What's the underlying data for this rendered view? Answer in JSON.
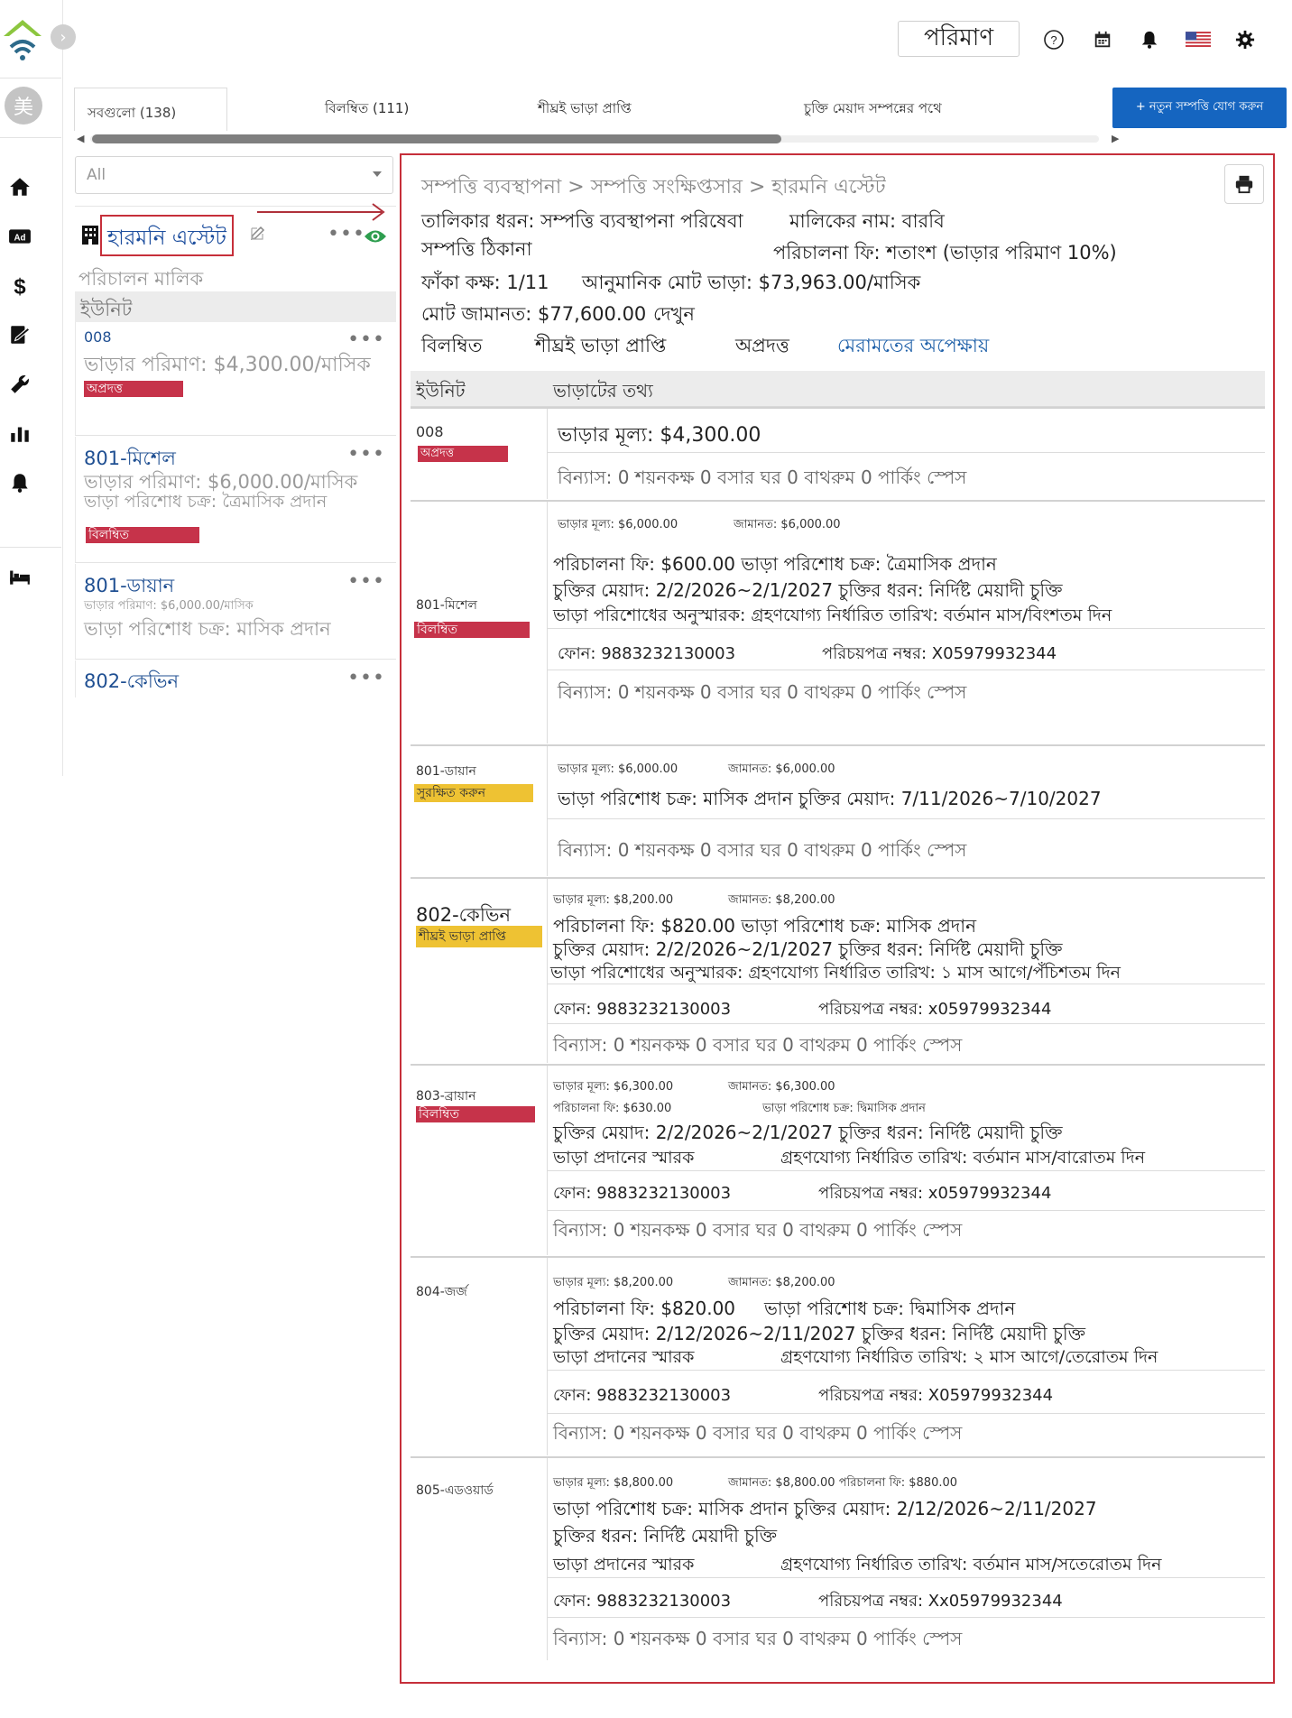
{
  "rail": {
    "avatar_text": "美"
  },
  "topbar": {
    "measure_label": "পরিমাণ"
  },
  "tabs": [
    {
      "label": "সবগুলো (138)"
    },
    {
      "label": "বিলম্বিত (111)"
    },
    {
      "label": "শীঘ্রই ভাড়া প্রাপ্তি"
    },
    {
      "label": "চুক্তি মেয়াদ সম্পন্নের পথে"
    }
  ],
  "add_button_label": "+ নতুন সম্পত্তি যোগ করুন",
  "filter": {
    "value": "All"
  },
  "property": {
    "name": "হারমনি এস্টেট",
    "owner": "পরিচালন মালিক",
    "units_heading": "ইউনিট"
  },
  "unit_list": [
    {
      "name": "008",
      "line1": "ভাড়ার পরিমাণ: $4,300.00/মাসিক",
      "line2": "",
      "badge": "অপ্রদত্ত"
    },
    {
      "name": "801-মিশেল",
      "line1": "ভাড়ার পরিমাণ: $6,000.00/মাসিক",
      "line2": "ভাড়া পরিশোধ চক্র: ত্রৈমাসিক প্রদান",
      "badge": "বিলম্বিত"
    },
    {
      "name": "801-ডায়ান",
      "line1": "ভাড়ার পরিমাণ: $6,000.00/মাসিক",
      "line2": "ভাড়া পরিশোধ চক্র: মাসিক প্রদান",
      "badge": ""
    },
    {
      "name": "802-কেভিন",
      "line1": "",
      "line2": "",
      "badge": ""
    }
  ],
  "detail": {
    "breadcrumb": "সম্পত্তি ব্যবস্থাপনা > সম্পত্তি সংক্ষিপ্তসার > হারমনি এস্টেট",
    "listing_type": "তালিকার ধরন: সম্পত্তি ব্যবস্থাপনা পরিষেবা",
    "owner_name": "মালিকের নাম: বারবি",
    "address_label": "সম্পত্তি ঠিকানা",
    "management_fee": "পরিচালনা ফি: শতাংশ (ভাড়ার পরিমাণ 10%)",
    "vacancy": "ফাঁকা কক্ষ: 1/11",
    "estimated_rent": "আনুমানিক মোট ভাড়া: $73,963.00/মাসিক",
    "total_deposit": "মোট জামানত: $77,600.00",
    "view_link": "দেখুন",
    "status_links": [
      "বিলম্বিত",
      "শীঘ্রই ভাড়া প্রাপ্তি",
      "অপ্রদত্ত",
      "মেরামতের অপেক্ষায়"
    ],
    "table_headers": {
      "unit": "ইউনিট",
      "tenant": "ভাড়াটের তথ্য"
    }
  },
  "rows": [
    {
      "unit": "008",
      "badge": "অপ্রদত্ত",
      "rent_big": "ভাড়ার মূল্য: $4,300.00",
      "layout": "বিন্যাস: 0 শয়নকক্ষ 0 বসার ঘর 0 বাথরুম 0 পার্কিং স্পেস"
    },
    {
      "unit": "801-মিশেল",
      "badge": "বিলম্বিত",
      "rent_small": "ভাড়ার মূল্য: $6,000.00",
      "deposit_small": "জামানত: $6,000.00",
      "line1": "পরিচালনা ফি: $600.00 ভাড়া পরিশোধ চক্র: ত্রৈমাসিক প্রদান",
      "line2": "চুক্তির মেয়াদ: 2/2/2026~2/1/2027 চুক্তির ধরন: নির্দিষ্ট মেয়াদী চুক্তি",
      "line3": "ভাড়া পরিশোধের অনুস্মারক: গ্রহণযোগ্য নির্ধারিত তারিখ: বর্তমান মাস/বিংশতম দিন",
      "phone": "ফোন: 9883232130003",
      "id_number": "পরিচয়পত্র নম্বর: X05979932344",
      "layout": "বিন্যাস: 0 শয়নকক্ষ 0 বসার ঘর 0 বাথরুম 0 পার্কিং স্পেস"
    },
    {
      "unit": "801-ডায়ান",
      "badge": "সুরক্ষিত করুন",
      "rent_small": "ভাড়ার মূল্য: $6,000.00",
      "deposit_small": "জামানত: $6,000.00",
      "line1": "ভাড়া পরিশোধ চক্র: মাসিক প্রদান চুক্তির মেয়াদ: 7/11/2026~7/10/2027",
      "layout": "বিন্যাস: 0 শয়নকক্ষ 0 বসার ঘর 0 বাথরুম 0 পার্কিং স্পেস"
    },
    {
      "unit": "802-কেভিন",
      "badge": "শীঘ্রই ভাড়া প্রাপ্তি",
      "rent_small": "ভাড়ার মূল্য: $8,200.00",
      "deposit_small": "জামানত: $8,200.00",
      "line1": "পরিচালনা ফি: $820.00 ভাড়া পরিশোধ চক্র: মাসিক প্রদান",
      "line2": "চুক্তির মেয়াদ: 2/2/2026~2/1/2027 চুক্তির ধরন: নির্দিষ্ট মেয়াদী চুক্তি",
      "line3": "ভাড়া পরিশোধের অনুস্মারক: গ্রহণযোগ্য নির্ধারিত তারিখ: ১ মাস আগে/পঁচিশতম দিন",
      "phone": "ফোন: 9883232130003",
      "id_number": "পরিচয়পত্র নম্বর: x05979932344",
      "layout": "বিন্যাস: 0 শয়নকক্ষ 0 বসার ঘর 0 বাথরুম 0 পার্কিং স্পেস"
    },
    {
      "unit": "803-ব্রায়ান",
      "badge": "বিলম্বিত",
      "rent_small": "ভাড়ার মূল্য: $6,300.00",
      "deposit_small": "জামানত: $6,300.00",
      "fee_small": "পরিচালনা ফি: $630.00",
      "cycle_small": "ভাড়া পরিশোধ চক্র: দ্বিমাসিক প্রদান",
      "line2": "চুক্তির মেয়াদ: 2/2/2026~2/1/2027 চুক্তির ধরন: নির্দিষ্ট মেয়াদী চুক্তি",
      "reminder": "ভাড়া প্রদানের স্মারক",
      "due": "গ্রহণযোগ্য নির্ধারিত তারিখ: বর্তমান মাস/বারোতম দিন",
      "phone": "ফোন: 9883232130003",
      "id_number": "পরিচয়পত্র নম্বর: x05979932344",
      "layout": "বিন্যাস: 0 শয়নকক্ষ 0 বসার ঘর 0 বাথরুম 0 পার্কিং স্পেস"
    },
    {
      "unit": "804-জর্জ",
      "rent_small": "ভাড়ার মূল্য: $8,200.00",
      "deposit_small": "জামানত: $8,200.00",
      "fee": "পরিচালনা ফি: $820.00",
      "cycle": "ভাড়া পরিশোধ চক্র: দ্বিমাসিক প্রদান",
      "line2": "চুক্তির মেয়াদ: 2/12/2026~2/11/2027 চুক্তির ধরন: নির্দিষ্ট মেয়াদী চুক্তি",
      "reminder": "ভাড়া প্রদানের স্মারক",
      "due": "গ্রহণযোগ্য নির্ধারিত তারিখ: ২ মাস আগে/তেরোতম দিন",
      "phone": "ফোন: 9883232130003",
      "id_number": "পরিচয়পত্র নম্বর: X05979932344",
      "layout": "বিন্যাস: 0 শয়নকক্ষ 0 বসার ঘর 0 বাথরুম 0 পার্কিং স্পেস"
    },
    {
      "unit": "805-এডওয়ার্ড",
      "small": "ভাড়ার মূল্য: $8,800.00",
      "small2": "জামানত: $8,800.00 পরিচালনা ফি: $880.00",
      "line1": "ভাড়া পরিশোধ চক্র: মাসিক প্রদান চুক্তির মেয়াদ: 2/12/2026~2/11/2027",
      "line2": "চুক্তির ধরন: নির্দিষ্ট মেয়াদী চুক্তি",
      "reminder": "ভাড়া প্রদানের স্মারক",
      "due": "গ্রহণযোগ্য নির্ধারিত তারিখ: বর্তমান মাস/সতেরোতম দিন",
      "phone": "ফোন: 9883232130003",
      "id_number": "পরিচয়পত্র নম্বর: Xx05979932344",
      "layout": "বিন্যাস: 0 শয়নকক্ষ 0 বসার ঘর 0 বাথরুম 0 পার্কিং স্পেস"
    }
  ]
}
